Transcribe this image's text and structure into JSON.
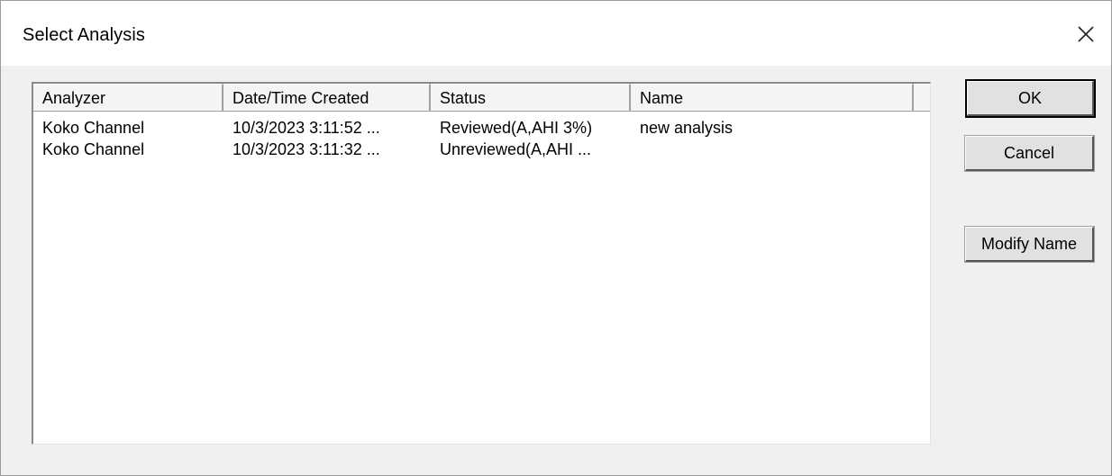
{
  "window": {
    "title": "Select Analysis"
  },
  "list": {
    "columns": [
      "Analyzer",
      "Date/Time Created",
      "Status",
      "Name",
      ""
    ],
    "rows": [
      [
        "Koko Channel",
        "10/3/2023 3:11:52 ...",
        "Reviewed(A,AHI 3%)",
        "new analysis"
      ],
      [
        "Koko Channel",
        "10/3/2023 3:11:32 ...",
        "Unreviewed(A,AHI ...",
        ""
      ]
    ]
  },
  "buttons": {
    "ok": "OK",
    "cancel": "Cancel",
    "modify_name": "Modify Name"
  },
  "icons": {
    "close": "close-icon"
  }
}
